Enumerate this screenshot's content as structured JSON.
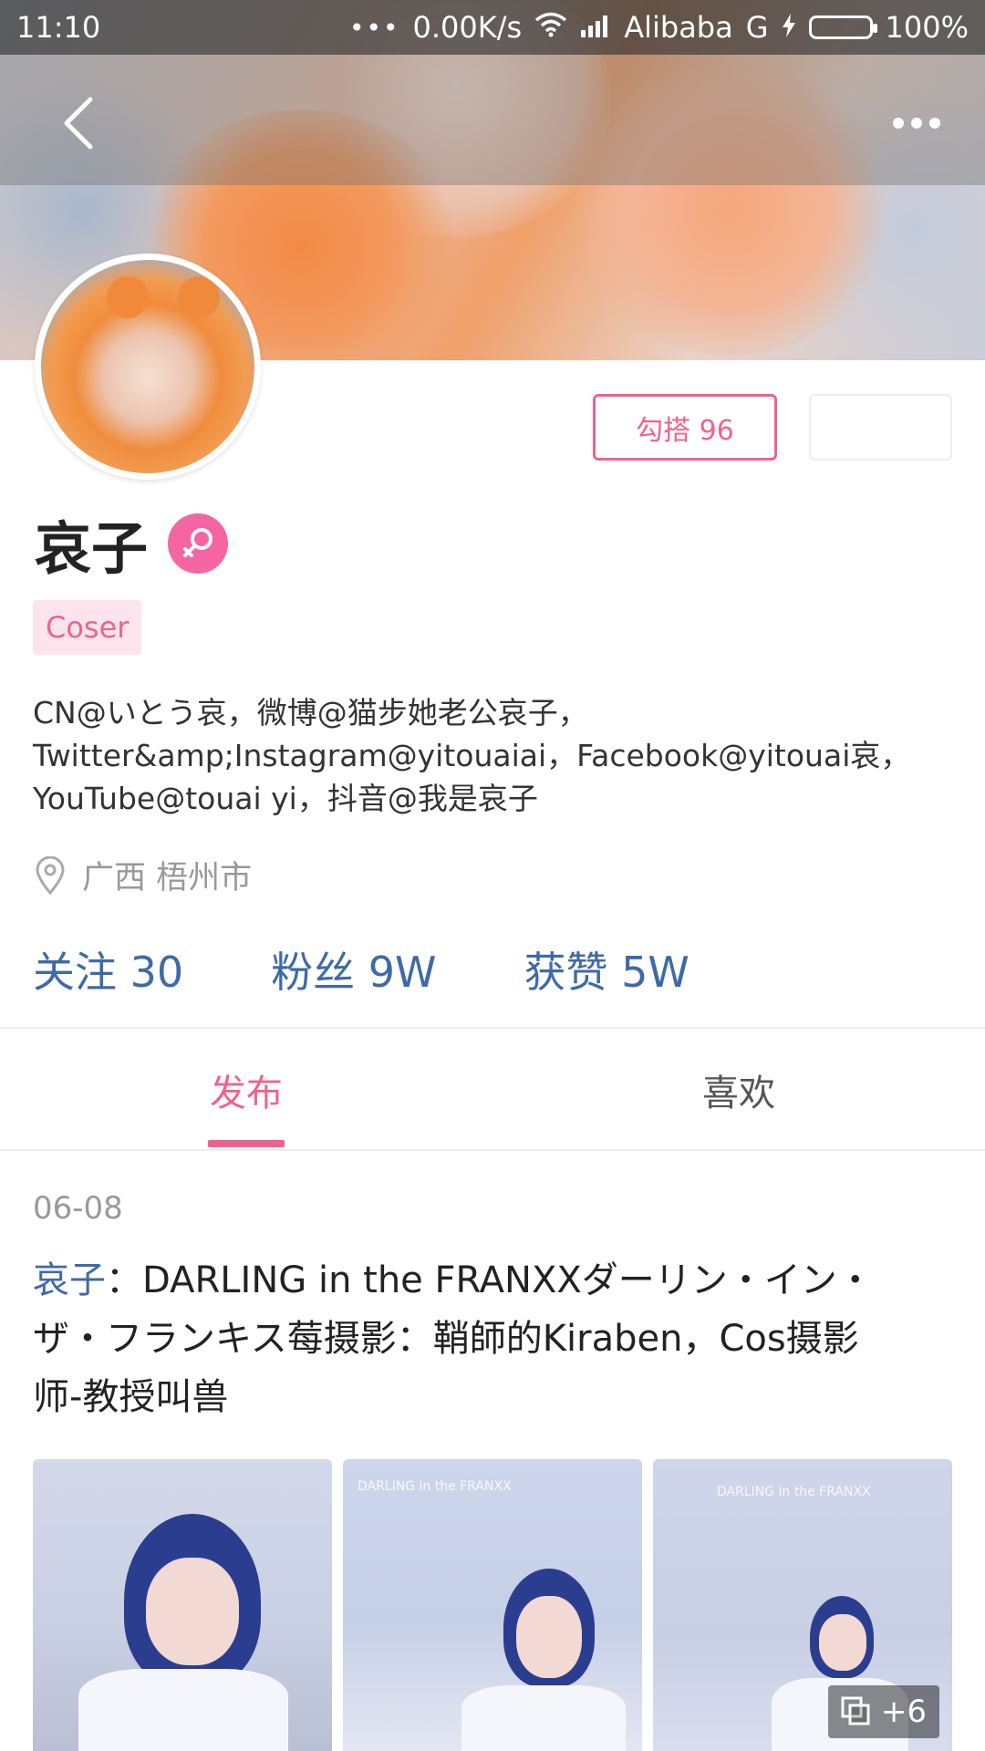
{
  "status_bar": {
    "time": "11:10",
    "network_speed": "0.00K/s",
    "carrier": "Alibaba",
    "network_type": "G",
    "battery": "100%"
  },
  "profile": {
    "follow_button_label": "勾搭 96",
    "name": "哀子",
    "role_tag": "Coser",
    "bio_lines": [
      "CN@いとう哀，微博@猫步她老公哀子，",
      "Twitter&amp;Instagram@yitouaiai，Facebook@yitouai哀，",
      "YouTube@touai yi，抖音@我是哀子"
    ],
    "location": "广西 梧州市",
    "stats": {
      "following": "关注 30",
      "fans": "粉丝 9W",
      "likes": "获赞 5W"
    }
  },
  "tabs": [
    {
      "label": "发布",
      "active": true
    },
    {
      "label": "喜欢",
      "active": false
    }
  ],
  "post": {
    "date": "06-08",
    "author": "哀子",
    "text_lines": [
      "：DARLING in the FRANXXダーリン・イン・",
      "ザ・フランキス莓摄影：鞘師的Kiraben，Cos摄影",
      "师-教授叫兽"
    ],
    "extra_images": "+6",
    "thumb_watermark": "DARLING in the FRANXX"
  },
  "colors": {
    "accent_pink": "#f0628e",
    "link_blue": "#3f6aa8",
    "gender_badge": "#f565a2",
    "battery_green": "#4cd43b"
  }
}
